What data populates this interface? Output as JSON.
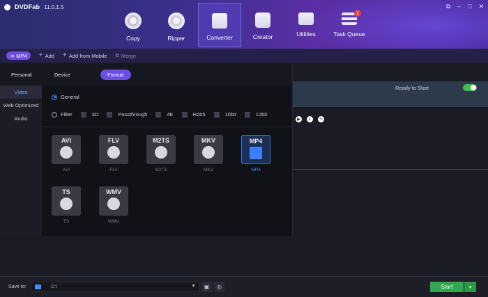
{
  "app": {
    "brand": "DVDFab",
    "version": "11.0.1.5"
  },
  "window_controls": [
    "restore-icon",
    "minimize-icon",
    "maximize-icon",
    "close-icon"
  ],
  "nav": [
    {
      "label": "Copy",
      "icon": "copy-disc-icon"
    },
    {
      "label": "Ripper",
      "icon": "ripper-disc-icon"
    },
    {
      "label": "Converter",
      "icon": "film-converter-icon",
      "active": true
    },
    {
      "label": "Creator",
      "icon": "creator-icon"
    },
    {
      "label": "Utilities",
      "icon": "utilities-folder-icon"
    },
    {
      "label": "Task Queue",
      "icon": "task-queue-icon",
      "badge": "1"
    }
  ],
  "toolbar": {
    "profile": "MP4",
    "add": "Add",
    "add_mobile": "Add from Mobile",
    "merge": "Merge"
  },
  "popup": {
    "tabs": [
      "Personal",
      "Device",
      "Format"
    ],
    "sidebar": [
      "Video",
      "Web Optimized",
      "Audio"
    ],
    "general_label": "General",
    "filter_label": "Filter",
    "filters": [
      "3D",
      "Passthrough",
      "4K",
      "H265",
      "10bit",
      "12bit"
    ],
    "formats": [
      {
        "title": "AVI",
        "label": "AVI",
        "icon": "film-strip-icon"
      },
      {
        "title": "FLV",
        "label": "FLV",
        "icon": "flash-icon"
      },
      {
        "title": "M2TS",
        "label": "M2TS",
        "icon": "film-reel-icon"
      },
      {
        "title": "MKV",
        "label": "MKV",
        "icon": "matroska-icon"
      },
      {
        "title": "MP4",
        "label": "MP4",
        "icon": "play-film-icon",
        "selected": true
      },
      {
        "title": "TS",
        "label": "TS",
        "icon": "camera-icon"
      },
      {
        "title": "WMV",
        "label": "WMV",
        "icon": "play-circle-icon"
      }
    ]
  },
  "task": {
    "status": "Ready to Start",
    "toggle_on": true
  },
  "bottom": {
    "save_to": "Save to:",
    "path": "D:\\",
    "start": "Start"
  },
  "colors": {
    "accent": "#6b4fe4",
    "selected_blue": "#3d74ea",
    "start_green": "#2fa84f"
  }
}
